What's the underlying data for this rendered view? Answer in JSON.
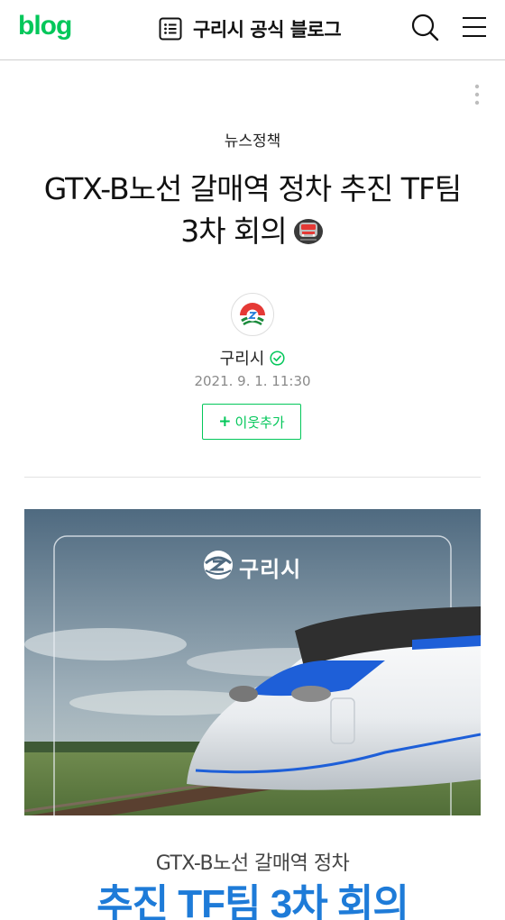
{
  "header": {
    "logo": "blog",
    "blog_title": "구리시 공식 블로그"
  },
  "post": {
    "category": "뉴스정책",
    "title_line1": "GTX-B노선 갈매역 정차 추진 TF팀",
    "title_line2": "3차 회의",
    "author": "구리시",
    "date": "2021. 9. 1. 11:30",
    "neighbor_plus": "+",
    "neighbor_label": "이웃추가"
  },
  "hero_image": {
    "brand": "구리시",
    "headline": "GTX-B노선 갈매역 정차",
    "main_text": "추진 TF팀 3차 회의"
  },
  "colors": {
    "brand_green": "#03c75a",
    "hero_blue": "#1e7bd8"
  },
  "icons": [
    "list-icon",
    "search-icon",
    "menu-icon",
    "more-icon",
    "train-emoji",
    "verified-icon"
  ]
}
